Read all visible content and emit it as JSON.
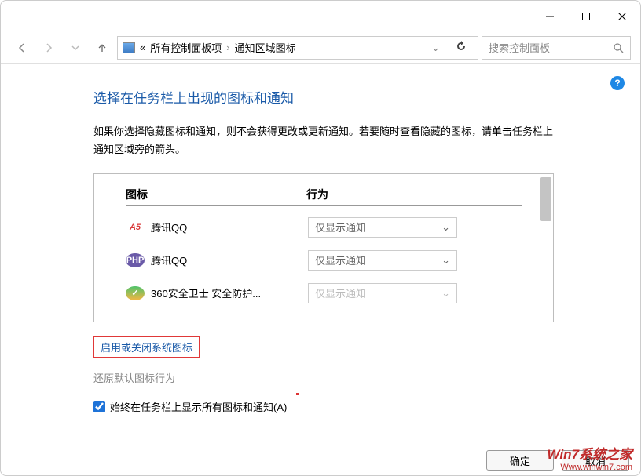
{
  "titlebar": {
    "min": "—",
    "max": "□",
    "close": "✕"
  },
  "nav": {
    "bc1": "所有控制面板项",
    "bc2": "通知区域图标",
    "search_placeholder": "搜索控制面板"
  },
  "page": {
    "heading": "选择在任务栏上出现的图标和通知",
    "desc": "如果你选择隐藏图标和通知，则不会获得更改或更新通知。若要随时查看隐藏的图标，请单击任务栏上通知区域旁的箭头。",
    "col_icon": "图标",
    "col_behavior": "行为",
    "rows": [
      {
        "name": "腾讯QQ",
        "behavior": "仅显示通知"
      },
      {
        "name": "腾讯QQ",
        "behavior": "仅显示通知"
      },
      {
        "name": "360安全卫士 安全防护...",
        "behavior": "仅显示通知"
      }
    ],
    "link_toggle": "启用或关闭系统图标",
    "link_reset": "还原默认图标行为",
    "checkbox_label": "始终在任务栏上显示所有图标和通知(A)",
    "btn_ok": "确定",
    "btn_cancel": "取消"
  },
  "watermark": {
    "l1": "Win7系统之家",
    "l2": "Www.winwin7.com"
  }
}
